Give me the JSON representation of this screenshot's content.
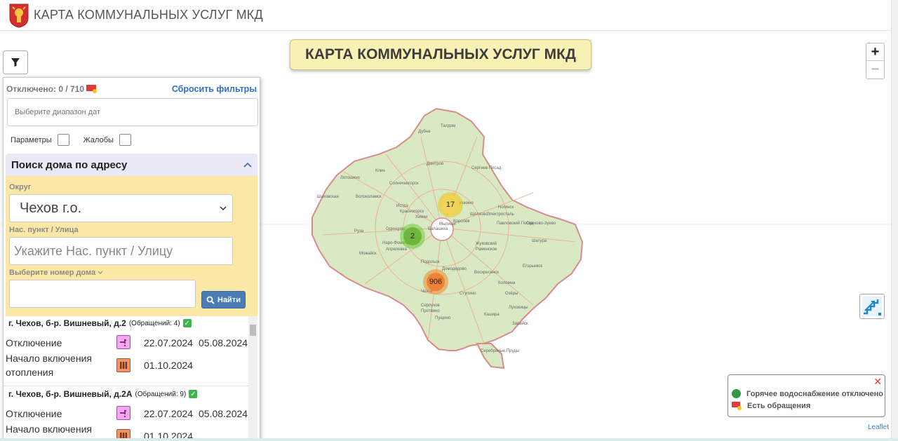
{
  "header": {
    "title": "КАРТА КОММУНАЛЬНЫХ УСЛУГ МКД"
  },
  "banner": {
    "title": "КАРТА КОММУНАЛЬНЫХ УСЛУГ МКД"
  },
  "zoom": {
    "in": "+",
    "out": "−"
  },
  "panel": {
    "status": "Отключено: 0 / 710",
    "reset": "Сбросить фильтры",
    "date_placeholder": "Выберите диапазон дат",
    "check_params": "Параметры",
    "check_complaints": "Жалобы",
    "search_title": "Поиск дома по адресу",
    "district_label": "Округ",
    "district_value": "Чехов г.о.",
    "street_label": "Нас. пункт / Улица",
    "street_placeholder": "Укажите Нас. пункт / Улицу",
    "house_label": "Выберите номер дома",
    "find_button": "Найти"
  },
  "results": [
    {
      "address": "г. Чехов, б-р. Вишневый, д.2",
      "count": "(Обращений: 4)",
      "events": [
        {
          "label": "Отключение",
          "date1": "22.07.2024",
          "date2": "05.08.2024",
          "icon": "hot-water-tap-icon"
        },
        {
          "label": "Начало включения отопления",
          "date1": "01.10.2024",
          "date2": "",
          "icon": "radiator-icon"
        }
      ]
    },
    {
      "address": "г. Чехов, б-р. Вишневый, д.2А",
      "count": "(Обращений: 9)",
      "events": [
        {
          "label": "Отключение",
          "date1": "22.07.2024",
          "date2": "05.08.2024",
          "icon": "hot-water-tap-icon"
        },
        {
          "label": "Начало включения отопления",
          "date1": "01.10.2024",
          "date2": "",
          "icon": "radiator-icon"
        }
      ]
    }
  ],
  "clusters": [
    {
      "count": "17",
      "color": "#f1d357"
    },
    {
      "count": "2",
      "color": "#6eb439"
    },
    {
      "count": "906",
      "color": "#f08032"
    }
  ],
  "legend": {
    "item1": "Горячее водоснабжение отключено",
    "item2": "Есть обращения",
    "close": "✕"
  },
  "attribution": "Leaflet",
  "map_labels": [
    "Дубна",
    "Талдом",
    "Дмитров",
    "Клин",
    "Сергиев Посад",
    "Солнечногорск",
    "Лотошино",
    "Шаховская",
    "Волоколамск",
    "Истра",
    "Руза",
    "Можайск",
    "Одинцово",
    "Мытищи",
    "Пушкино",
    "Щёлково",
    "Королёв",
    "Балашиха",
    "Ногинск",
    "Электросталь",
    "Павловский Посад",
    "Орехово-Зуево",
    "Шатура",
    "Егорьевск",
    "Раменское",
    "Жуковский",
    "Воскресенск",
    "Коломна",
    "Луховицы",
    "Зарайск",
    "Домодедово",
    "Подольск",
    "Чехов",
    "Серпухов",
    "Протвино",
    "Пущино",
    "Ступино",
    "Кашира",
    "Озёры",
    "Серебряные Пруды",
    "Наро-Фоминск",
    "Химки",
    "Красногорск",
    "Апрелевка"
  ]
}
